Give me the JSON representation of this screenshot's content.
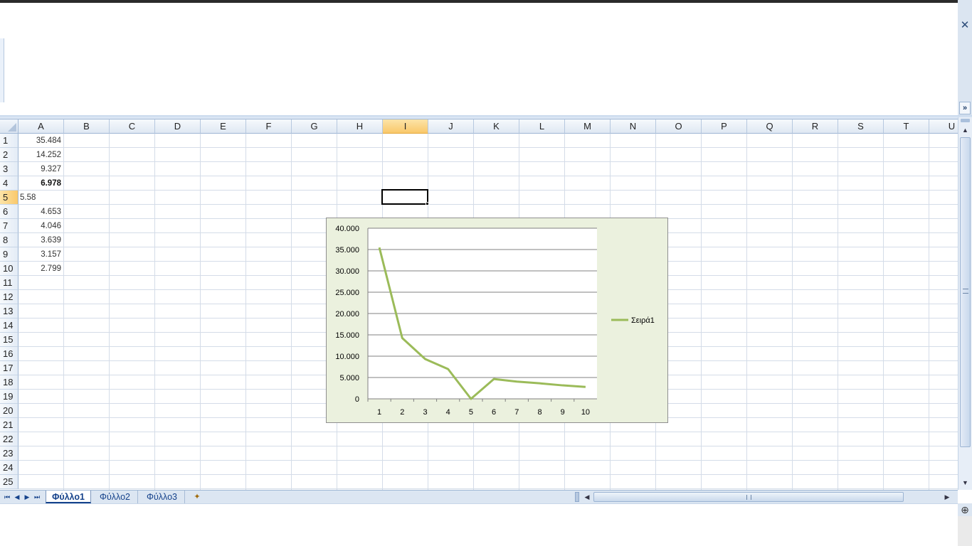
{
  "window": {
    "close_glyph": "✕",
    "ribbon_expand_glyph": "»"
  },
  "sheet": {
    "columns": [
      "A",
      "B",
      "C",
      "D",
      "E",
      "F",
      "G",
      "H",
      "I",
      "J",
      "K",
      "L",
      "M",
      "N",
      "O",
      "P",
      "Q",
      "R",
      "S",
      "T",
      "U"
    ],
    "rows": [
      "1",
      "2",
      "3",
      "4",
      "5",
      "6",
      "7",
      "8",
      "9",
      "10",
      "11",
      "12",
      "13",
      "14",
      "15",
      "16",
      "17",
      "18",
      "19",
      "20",
      "21",
      "22",
      "23",
      "24",
      "25"
    ],
    "selected_column": "I",
    "selected_row": "5",
    "cells_A": [
      "35.484",
      "14.252",
      "9.327",
      "6.978",
      "5.58",
      "4.653",
      "4.046",
      "3.639",
      "3.157",
      "2.799"
    ]
  },
  "chart_data": {
    "type": "line",
    "categories": [
      1,
      2,
      3,
      4,
      5,
      6,
      7,
      8,
      9,
      10
    ],
    "series": [
      {
        "name": "Σειρά1",
        "values": [
          35484,
          14252,
          9327,
          6978,
          0,
          4653,
          4046,
          3639,
          3157,
          2799
        ],
        "color": "#9bbb59"
      }
    ],
    "ylim": [
      0,
      40000
    ],
    "yticks": [
      "0",
      "5.000",
      "10.000",
      "15.000",
      "20.000",
      "25.000",
      "30.000",
      "35.000",
      "40.000"
    ],
    "xticks": [
      "1",
      "2",
      "3",
      "4",
      "5",
      "6",
      "7",
      "8",
      "9",
      "10"
    ],
    "grid": true,
    "legend": "right",
    "colors": {
      "chart_bg": "#ebf1de",
      "plot_bg": "#ffffff",
      "gridline": "#808080"
    }
  },
  "tabs": {
    "nav": [
      "⏮",
      "◀",
      "▶",
      "⏭"
    ],
    "sheets": [
      "Φύλλο1",
      "Φύλλο2",
      "Φύλλο3"
    ],
    "active_sheet": "Φύλλο1",
    "new_sheet_icon": "insert-worksheet-icon"
  },
  "scrollbars": {
    "up": "▲",
    "down": "▼",
    "left": "◀",
    "right": "▶"
  },
  "status": {
    "zoom_glyph": "⊕"
  }
}
